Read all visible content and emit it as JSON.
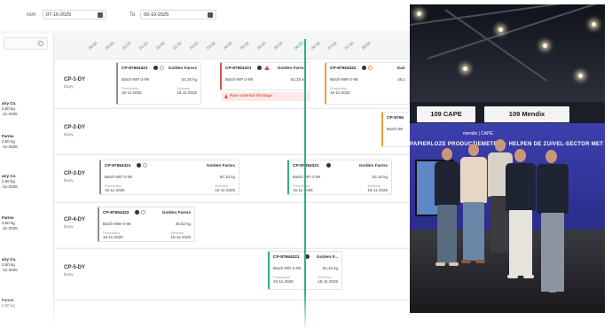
{
  "filters": {
    "from_label": "rom",
    "from_value": "07-10-2025",
    "to_label": "To",
    "to_value": "09-10-2025"
  },
  "timeline": {
    "ticks": [
      "00:00",
      "00:30",
      "01:00",
      "01:30",
      "02:00",
      "02:30",
      "03:00",
      "03:30",
      "04:00",
      "04:30",
      "05:00",
      "05:30",
      "06:00",
      "06:30",
      "07:00",
      "07:30",
      "08:00"
    ],
    "current_tick": "06:00"
  },
  "left_panel": {
    "items": [
      {
        "name": "airy Co.",
        "weight": "2,50 kg",
        "date": "-11-2025"
      },
      {
        "name": "Farms",
        "weight": "2,50 kg",
        "date": "-11-2025"
      },
      {
        "name": "airy Co.",
        "weight": "2,50 kg",
        "date": "-11-2025"
      },
      {
        "name": "Farms",
        "weight": "2,50 kg",
        "date": "-11-2025"
      },
      {
        "name": "airy Co.",
        "weight": "2,50 kg",
        "date": "-11-2025"
      },
      {
        "name": "Farms",
        "weight": "2,50 kg",
        "date": ""
      }
    ]
  },
  "lanes": [
    {
      "title": "CP-1-DY",
      "sub": "Dairy"
    },
    {
      "title": "CP-2-DY",
      "sub": "Dairy"
    },
    {
      "title": "CP-3-DY",
      "sub": "Dairy"
    },
    {
      "title": "CP-4-DY",
      "sub": "Dairy"
    },
    {
      "title": "CP-5-DY",
      "sub": "Dairy"
    }
  ],
  "cards": [
    {
      "id": "CP-87654321",
      "client": "Golden Farms",
      "batch": "Batch-987-2-99",
      "weight": "52,15 kg",
      "prod_label": "Production",
      "prod_date": "15-11-2025",
      "del_label": "Delivery",
      "del_date": "18-11-2025",
      "accent": "#8a8f98"
    },
    {
      "id": "CP-87654321",
      "client": "Golden Farms",
      "batch": "Batch-987-2-99",
      "weight": "52,15 kg",
      "prod_label": "",
      "prod_date": "",
      "del_label": "",
      "del_date": "",
      "accent": "#d9534f"
    },
    {
      "id": "CP-87654322",
      "client": "Dair",
      "batch": "Batch-989-X-98",
      "weight": "36,1",
      "prod_label": "Production",
      "prod_date": "16-11-2025",
      "del_label": "",
      "del_date": "",
      "accent": "#f0a030"
    },
    {
      "id": "CP-8765",
      "client": "",
      "batch": "Batch-98",
      "weight": "",
      "prod_label": "",
      "prod_date": "",
      "del_label": "",
      "del_date": "",
      "accent": "#f0a030"
    },
    {
      "id": "CP-87654321",
      "client": "Golden Farms",
      "batch": "Batch-987-2-99",
      "weight": "52,15 kg",
      "prod_label": "Production",
      "prod_date": "15-11-2025",
      "del_label": "Delivery",
      "del_date": "18-11-2025",
      "accent": "#8a8f98"
    },
    {
      "id": "CP-87654321",
      "client": "Golden Farms",
      "batch": "Batch-987-2-99",
      "weight": "52,15 kg",
      "prod_label": "Production",
      "prod_date": "15-11-2025",
      "del_label": "Delivery",
      "del_date": "18-11-2025",
      "accent": "#2fb184"
    },
    {
      "id": "CP-87654322",
      "client": "Golden Farms",
      "batch": "Batch-989-X-98",
      "weight": "36,52 kg",
      "prod_label": "Production",
      "prod_date": "16-11-2025",
      "del_label": "Delivery",
      "del_date": "19-11-2025",
      "accent": "#8a8f98"
    },
    {
      "id": "CP-87654321",
      "client": "Golden F...",
      "batch": "Batch-987-2-99",
      "weight": "52,15 kg",
      "prod_label": "Production",
      "prod_date": "15-11-2025",
      "del_label": "Delivery",
      "del_date": "18-11-2025",
      "accent": "#2fb184"
    }
  ],
  "alert": {
    "text": "Raw material shortage",
    "color": "#c0392b"
  },
  "photo": {
    "sign_left": "109 CAPE",
    "sign_right": "109 Mendix",
    "booth_logos": "mendix | CAPE",
    "banner": "PAPIERLOZE PRODUCTIEMETRIE · HELPEN DE ZUIVEL-SECTOR MET"
  },
  "colors": {
    "now_line": "#2fb184",
    "booth": "#3d3fae"
  }
}
